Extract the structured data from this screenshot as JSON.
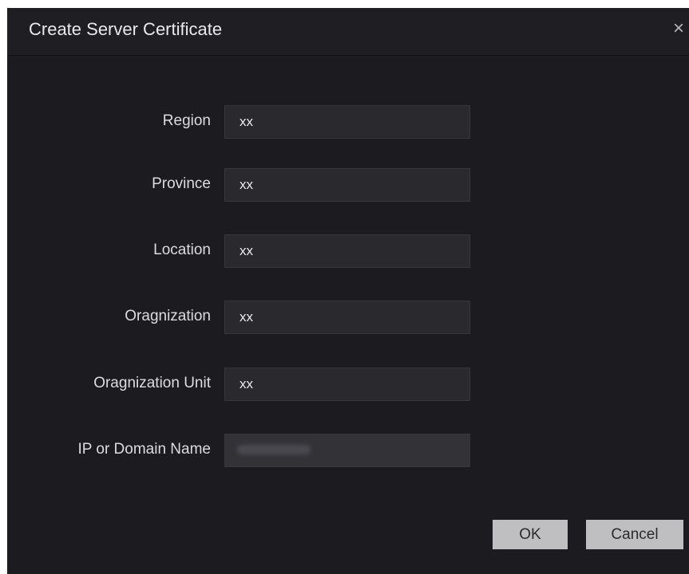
{
  "dialog": {
    "title": "Create Server Certificate",
    "close_icon": "×"
  },
  "form": {
    "fields": [
      {
        "label": "Region",
        "value": "xx"
      },
      {
        "label": "Province",
        "value": "xx"
      },
      {
        "label": "Location",
        "value": "xx"
      },
      {
        "label": "Oragnization",
        "value": "xx"
      },
      {
        "label": "Oragnization Unit",
        "value": "xx"
      },
      {
        "label": "IP or Domain Name",
        "value": ""
      }
    ]
  },
  "buttons": {
    "ok": "OK",
    "cancel": "Cancel"
  },
  "colors": {
    "dialog_bg": "#1c1c20",
    "field_bg": "#2a292e",
    "button_bg": "#bfbfc2"
  }
}
